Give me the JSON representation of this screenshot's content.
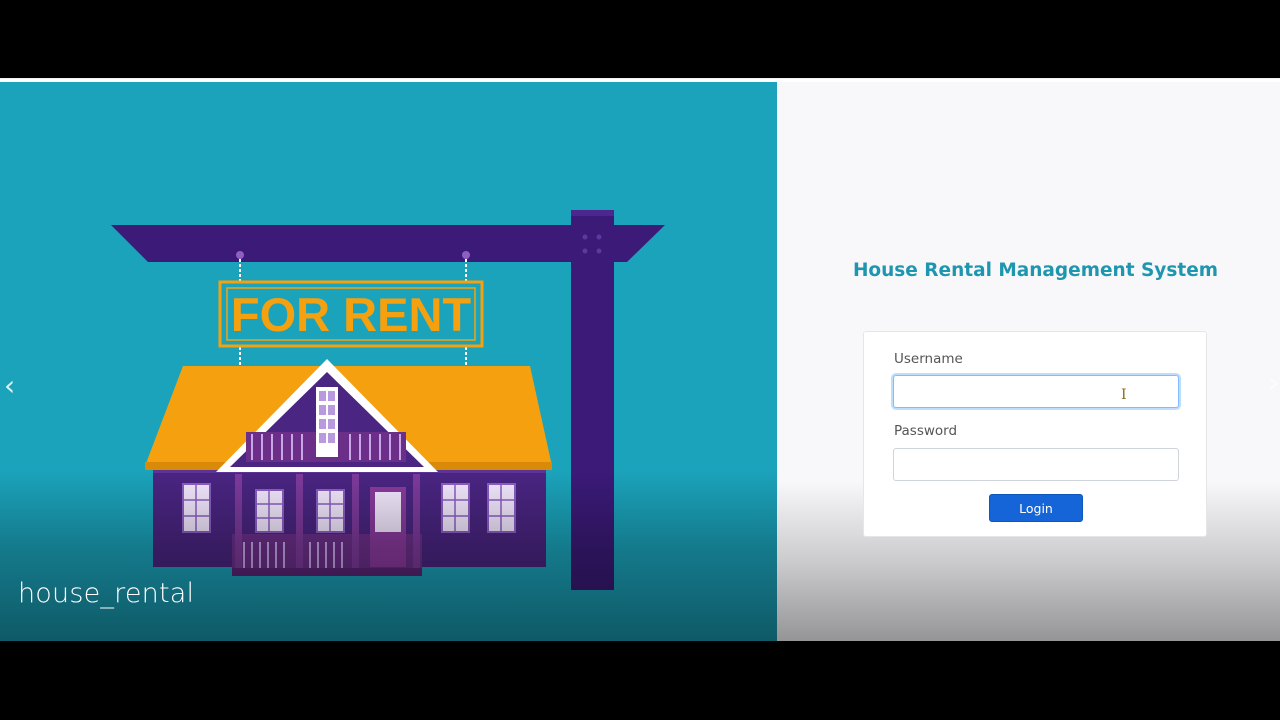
{
  "carousel": {
    "caption": "house_rental",
    "sign_text": "FOR RENT",
    "prev_icon": "chevron-left-icon",
    "next_icon": "chevron-right-icon",
    "prev_glyph": "‹",
    "next_glyph": "›"
  },
  "login": {
    "title": "House Rental Management System",
    "username_label": "Username",
    "username_value": "",
    "password_label": "Password",
    "password_value": "",
    "button_label": "Login"
  },
  "colors": {
    "left_bg": "#1ba3bb",
    "title": "#1e96b0",
    "button": "#1565d8",
    "roof": "#f5a10f",
    "house": "#4a2582",
    "post": "#3b1a78"
  }
}
